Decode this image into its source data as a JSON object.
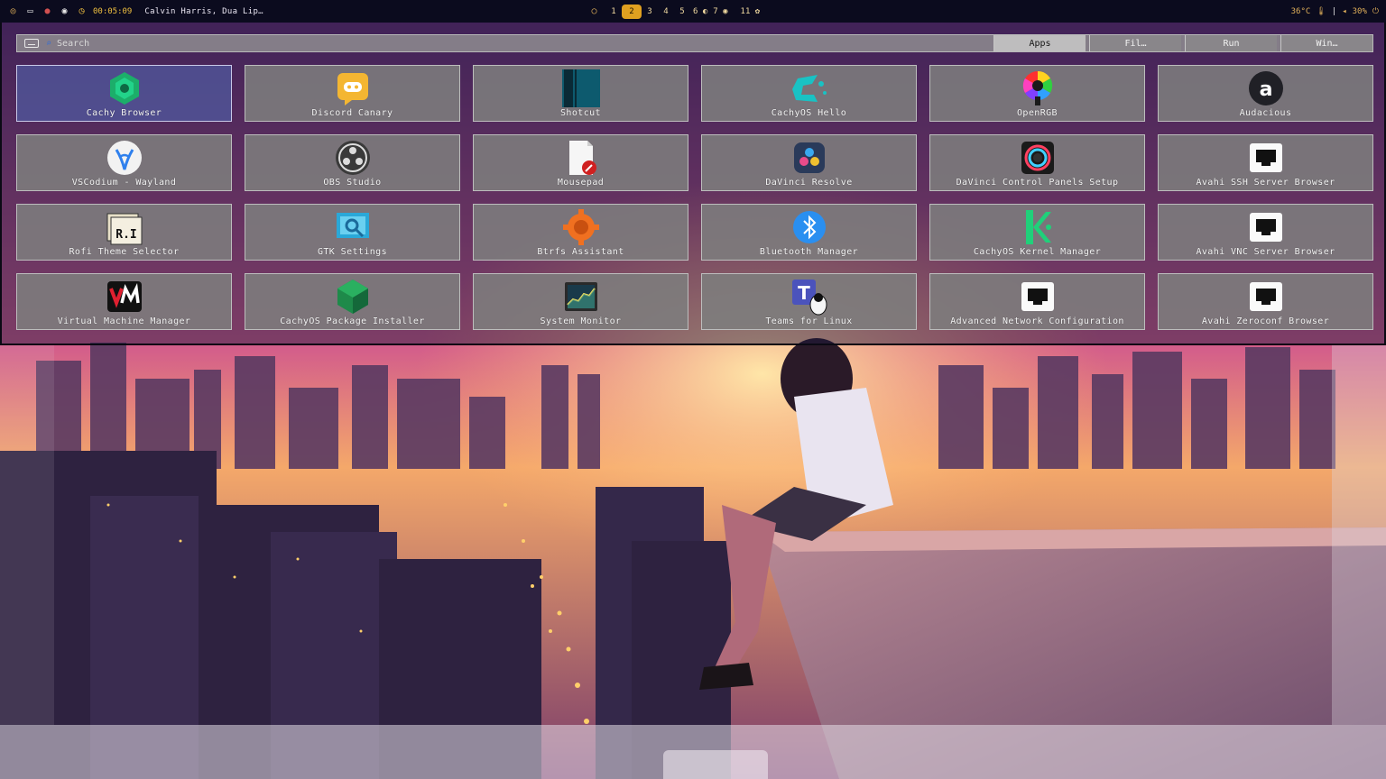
{
  "topbar": {
    "left_icons": [
      "idle-inhibitor-icon",
      "window-icon",
      "recording-icon",
      "discord-icon"
    ],
    "clock": "00:05:09",
    "media": "Calvin Harris, Dua Lip…",
    "workspaces": [
      {
        "label": "1",
        "active": false
      },
      {
        "label": "2",
        "active": true
      },
      {
        "label": "3",
        "active": false
      },
      {
        "label": "4",
        "active": false
      },
      {
        "label": "5",
        "active": false
      },
      {
        "label": "6",
        "active": false
      },
      {
        "label": "7",
        "active": false
      },
      {
        "label": "11",
        "active": false
      }
    ],
    "temperature": "36°C",
    "separator": "|",
    "volume": "30%"
  },
  "launcher": {
    "search": {
      "placeholder": "Search",
      "value": ""
    },
    "modes": [
      {
        "label": "Apps",
        "active": true
      },
      {
        "label": "Fil…",
        "active": false
      },
      {
        "label": "Run",
        "active": false
      },
      {
        "label": "Win…",
        "active": false
      }
    ],
    "apps": [
      {
        "label": "Cachy Browser",
        "icon": "cachy-browser-icon",
        "selected": true
      },
      {
        "label": "Discord Canary",
        "icon": "discord-canary-icon"
      },
      {
        "label": "Shotcut",
        "icon": "shotcut-icon"
      },
      {
        "label": "CachyOS Hello",
        "icon": "cachyos-hello-icon"
      },
      {
        "label": "OpenRGB",
        "icon": "openrgb-icon"
      },
      {
        "label": "Audacious",
        "icon": "audacious-icon"
      },
      {
        "label": "VSCodium - Wayland",
        "icon": "vscodium-icon"
      },
      {
        "label": "OBS Studio",
        "icon": "obs-studio-icon"
      },
      {
        "label": "Mousepad",
        "icon": "mousepad-icon"
      },
      {
        "label": "DaVinci Resolve",
        "icon": "davinci-resolve-icon"
      },
      {
        "label": "DaVinci Control Panels Setup",
        "icon": "davinci-control-panels-icon"
      },
      {
        "label": "Avahi SSH Server Browser",
        "icon": "network-port-icon"
      },
      {
        "label": "Rofi Theme Selector",
        "icon": "rofi-theme-icon"
      },
      {
        "label": "GTK Settings",
        "icon": "gtk-settings-icon"
      },
      {
        "label": "Btrfs Assistant",
        "icon": "btrfs-assistant-icon"
      },
      {
        "label": "Bluetooth Manager",
        "icon": "bluetooth-icon"
      },
      {
        "label": "CachyOS Kernel Manager",
        "icon": "kernel-manager-icon"
      },
      {
        "label": "Avahi VNC Server Browser",
        "icon": "network-port-icon"
      },
      {
        "label": "Virtual Machine Manager",
        "icon": "virt-manager-icon"
      },
      {
        "label": "CachyOS Package Installer",
        "icon": "package-installer-icon"
      },
      {
        "label": "System Monitor",
        "icon": "system-monitor-icon"
      },
      {
        "label": "Teams for Linux",
        "icon": "teams-icon"
      },
      {
        "label": "Advanced Network Configuration",
        "icon": "network-port-icon"
      },
      {
        "label": "Avahi Zeroconf Browser",
        "icon": "network-port-icon"
      }
    ]
  },
  "colors": {
    "accent": "#e0a020",
    "bar_bg": "#0b0b1e",
    "tile_bg": "#7d7d7d",
    "tile_selected": "#5054a0"
  }
}
